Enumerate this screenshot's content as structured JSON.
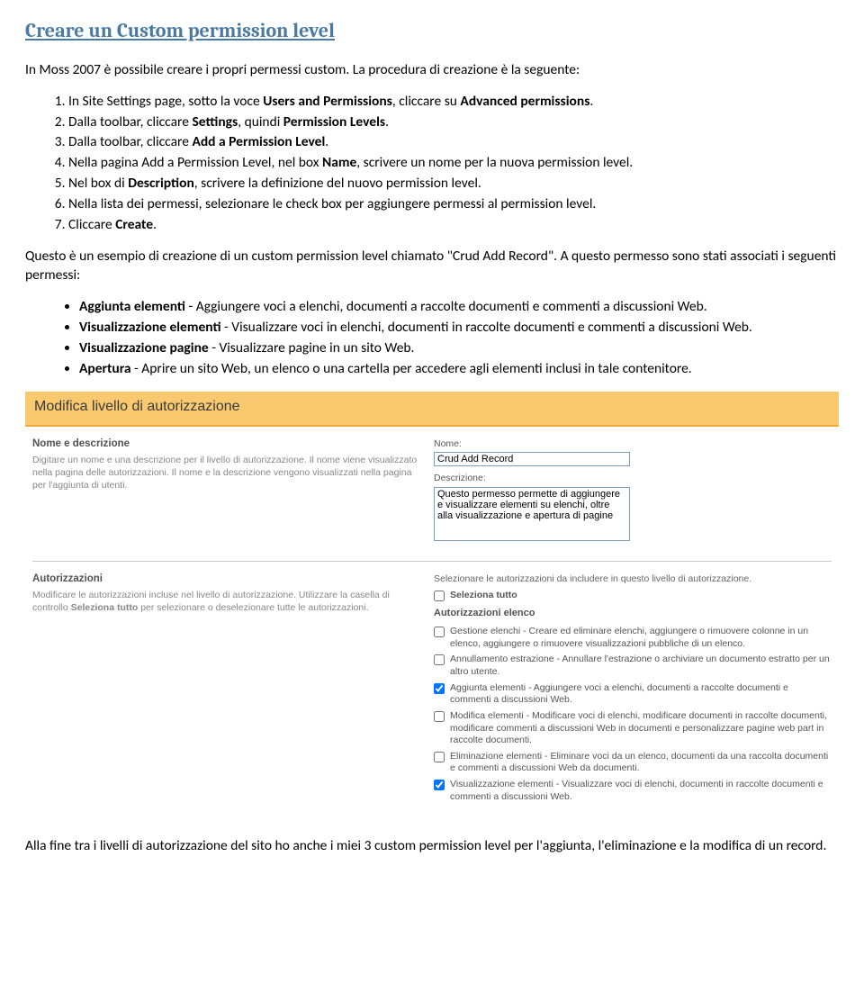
{
  "heading": "Creare un Custom permission level",
  "intro": "In Moss 2007 è possibile creare i propri permessi custom. La procedura di creazione è la seguente:",
  "steps": [
    {
      "pre": "In Site Settings page, sotto la voce ",
      "b1": "Users and Permissions",
      "mid1": ", cliccare su ",
      "b2": "Advanced permissions",
      "post": "."
    },
    {
      "pre": "Dalla toolbar, cliccare ",
      "b1": "Settings",
      "mid1": ", quindi ",
      "b2": "Permission Levels",
      "post": "."
    },
    {
      "pre": "Dalla toolbar, cliccare ",
      "b1": "Add a Permission Level",
      "post": "."
    },
    {
      "pre": "Nella pagina Add a Permission Level, nel box ",
      "b1": "Name",
      "post": ",  scrivere un nome per la nuova permission level."
    },
    {
      "pre": "Nel box di ",
      "b1": "Description",
      "post": ", scrivere la definizione del nuovo permission level."
    },
    {
      "pre": "Nella lista dei permessi, selezionare le check box per aggiungere permessi al permission level.",
      "post": ""
    },
    {
      "pre": "Cliccare ",
      "b1": "Create",
      "post": "."
    }
  ],
  "example_para": "Questo è un esempio di creazione di un custom permission level chiamato \"Crud Add Record\". A questo permesso sono stati associati i seguenti permessi:",
  "perm_bullets": [
    {
      "b": "Aggiunta elementi",
      "t": "  -  Aggiungere voci a elenchi, documenti a raccolte documenti e commenti a discussioni Web."
    },
    {
      "b": "Visualizzazione elementi",
      "t": "  -  Visualizzare voci in elenchi, documenti in raccolte documenti e commenti a discussioni Web."
    },
    {
      "b": "Visualizzazione pagine",
      "t": "  -  Visualizzare pagine in un sito Web."
    },
    {
      "b": "Apertura",
      "t": "  -  Aprire un sito Web, un elenco o una cartella per accedere agli elementi inclusi in tale contenitore."
    }
  ],
  "ui": {
    "title": "Modifica livello di autorizzazione",
    "name_section": {
      "h": "Nome e descrizione",
      "desc": "Digitare un nome e una descrizione per il livello di autorizzazione. Il nome viene visualizzato nella pagina delle autorizzazioni. Il nome e la descrizione vengono visualizzati nella pagina per l'aggiunta di utenti.",
      "name_label": "Nome:",
      "name_value": "Crud Add Record",
      "desc_label": "Descrizione:",
      "desc_value": "Questo permesso permette di aggiungere e visualizzare elementi su elenchi, oltre alla visualizzazione e apertura di pagine"
    },
    "auth_section": {
      "h": "Autorizzazioni",
      "desc_pre": "Modificare le autorizzazioni incluse nel livello di autorizzazione. Utilizzare la casella di controllo ",
      "desc_bold": "Seleziona tutto",
      "desc_post": " per selezionare o deselezionare tutte le autorizzazioni.",
      "right_note": "Selezionare le autorizzazioni da includere in questo livello di autorizzazione.",
      "select_all": "Seleziona tutto",
      "cat_label": "Autorizzazioni elenco",
      "perms": [
        {
          "checked": false,
          "text": "Gestione elenchi  -  Creare ed eliminare elenchi, aggiungere o rimuovere colonne in un elenco, aggiungere o rimuovere visualizzazioni pubbliche di un elenco."
        },
        {
          "checked": false,
          "text": "Annullamento estrazione  -  Annullare l'estrazione o archiviare un documento estratto per un altro utente."
        },
        {
          "checked": true,
          "text": "Aggiunta elementi  -  Aggiungere voci a elenchi, documenti a raccolte documenti e commenti a discussioni Web."
        },
        {
          "checked": false,
          "text": "Modifica elementi  -  Modificare voci di elenchi, modificare documenti in raccolte documenti, modificare commenti a discussioni Web in documenti e personalizzare pagine web part in raccolte documenti."
        },
        {
          "checked": false,
          "text": "Eliminazione elementi  -  Eliminare voci da un elenco, documenti da una raccolta documenti e commenti a discussioni Web da documenti."
        },
        {
          "checked": true,
          "text": "Visualizzazione elementi  -  Visualizzare voci di elenchi, documenti in raccolte documenti e commenti a discussioni Web."
        }
      ]
    }
  },
  "closing": "Alla fine tra i livelli di autorizzazione del sito ho anche i miei 3 custom permission level per l'aggiunta, l'eliminazione e la modifica di un record."
}
